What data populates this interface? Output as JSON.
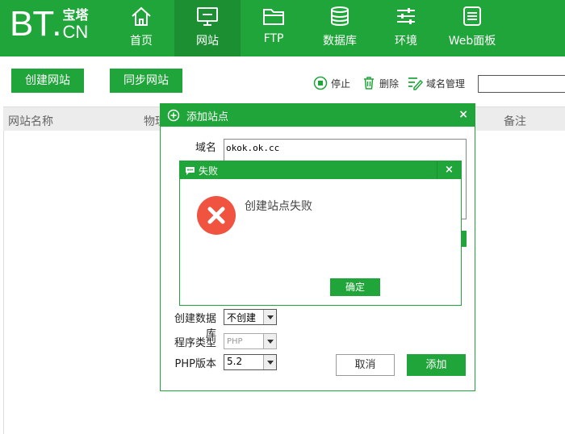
{
  "brand": {
    "logo_main": "BT",
    "logo_dot": ".",
    "logo_cn_top": "宝塔",
    "logo_cn_bottom": "CN"
  },
  "nav": [
    {
      "label": "首页",
      "icon": "home-icon"
    },
    {
      "label": "网站",
      "icon": "monitor-icon",
      "active": true
    },
    {
      "label": "FTP",
      "icon": "folder-icon"
    },
    {
      "label": "数据库",
      "icon": "database-icon"
    },
    {
      "label": "环境",
      "icon": "sliders-icon"
    },
    {
      "label": "Web面板",
      "icon": "panel-icon"
    }
  ],
  "toolbar": {
    "create_site": "创建网站",
    "sync_site": "同步网站",
    "stop": "停止",
    "delete": "删除",
    "domain_manage": "域名管理",
    "domain_input_value": ""
  },
  "table": {
    "headers": [
      "网站名称",
      "物理",
      "备注"
    ]
  },
  "add_dialog": {
    "title": "添加站点",
    "domain_label": "域名",
    "domain_value": "okok.ok.cc",
    "create_db_label": "创建数据库",
    "create_db_value": "不创建",
    "program_type_label": "程序类型",
    "program_type_value": "PHP",
    "php_version_label": "PHP版本",
    "php_version_value": "5.2",
    "cancel": "取消",
    "add": "添加",
    "close": "×"
  },
  "error_dialog": {
    "title": "失败",
    "message": "创建站点失败",
    "ok": "确定",
    "close": "×"
  },
  "colors": {
    "brand_green": "#20a53a",
    "active_nav": "#1b8f32",
    "error_red": "#f0533f"
  }
}
